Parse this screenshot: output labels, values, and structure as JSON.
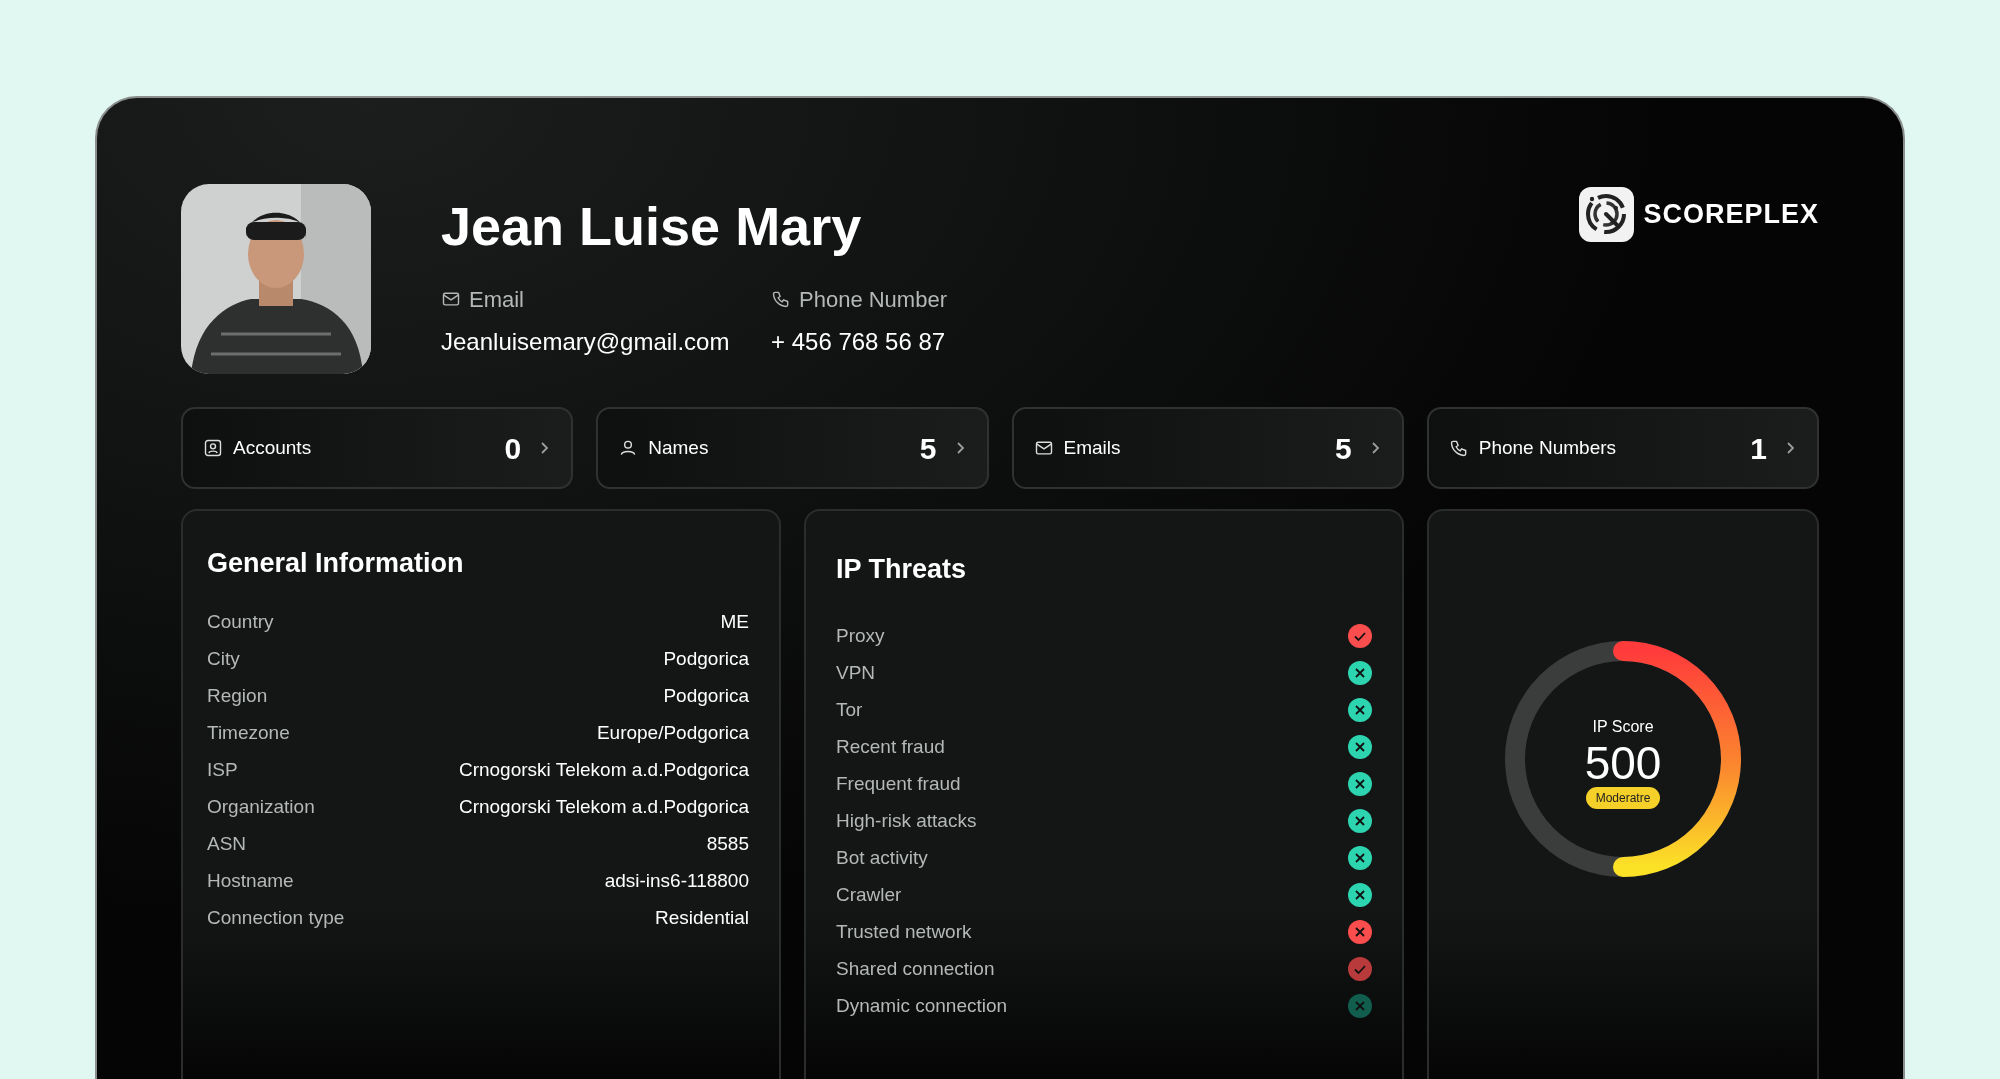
{
  "profile": {
    "name": "Jean Luise Mary",
    "contacts": [
      {
        "kind": "email",
        "label": "Email",
        "value": "Jeanluisemary@gmail.com"
      },
      {
        "kind": "phone",
        "label": "Phone Number",
        "value": "+ 456 768 56 87"
      }
    ]
  },
  "brand": {
    "name": "SCOREPLEX"
  },
  "stats": [
    {
      "kind": "accounts",
      "label": "Accounts",
      "count": "0"
    },
    {
      "kind": "names",
      "label": "Names",
      "count": "5"
    },
    {
      "kind": "emails",
      "label": "Emails",
      "count": "5"
    },
    {
      "kind": "phones",
      "label": "Phone Numbers",
      "count": "1"
    }
  ],
  "general_info": {
    "title": "General Information",
    "rows": [
      {
        "label": "Country",
        "value": "ME"
      },
      {
        "label": "City",
        "value": "Podgorica"
      },
      {
        "label": "Region",
        "value": "Podgorica"
      },
      {
        "label": "Timezone",
        "value": "Europe/Podgorica"
      },
      {
        "label": "ISP",
        "value": "Crnogorski Telekom a.d.Podgorica"
      },
      {
        "label": "Organization",
        "value": "Crnogorski Telekom a.d.Podgorica"
      },
      {
        "label": "ASN",
        "value": "8585"
      },
      {
        "label": "Hostname",
        "value": "adsi-ins6-118800"
      },
      {
        "label": "Connection type",
        "value": "Residential"
      }
    ]
  },
  "ip_threats": {
    "title": "IP Threats",
    "items": [
      {
        "label": "Proxy",
        "detected": true,
        "color": "#fa4d4d"
      },
      {
        "label": "VPN",
        "detected": false,
        "color": "#2dd4b0"
      },
      {
        "label": "Tor",
        "detected": false,
        "color": "#2dd4b0"
      },
      {
        "label": "Recent fraud",
        "detected": false,
        "color": "#2dd4b0"
      },
      {
        "label": "Frequent fraud",
        "detected": false,
        "color": "#2dd4b0"
      },
      {
        "label": "High-risk attacks",
        "detected": false,
        "color": "#2dd4b0"
      },
      {
        "label": "Bot activity",
        "detected": false,
        "color": "#2dd4b0"
      },
      {
        "label": "Crawler",
        "detected": false,
        "color": "#2dd4b0"
      },
      {
        "label": "Trusted network",
        "detected": false,
        "color": "#fa4d4d"
      },
      {
        "label": "Shared connection",
        "detected": true,
        "color": "#b83a3a"
      },
      {
        "label": "Dynamic connection",
        "detected": false,
        "color": "#125e4e"
      }
    ]
  },
  "ip_score": {
    "label": "IP Score",
    "value": "500",
    "badge": "Moderatre",
    "level": 0.5
  }
}
